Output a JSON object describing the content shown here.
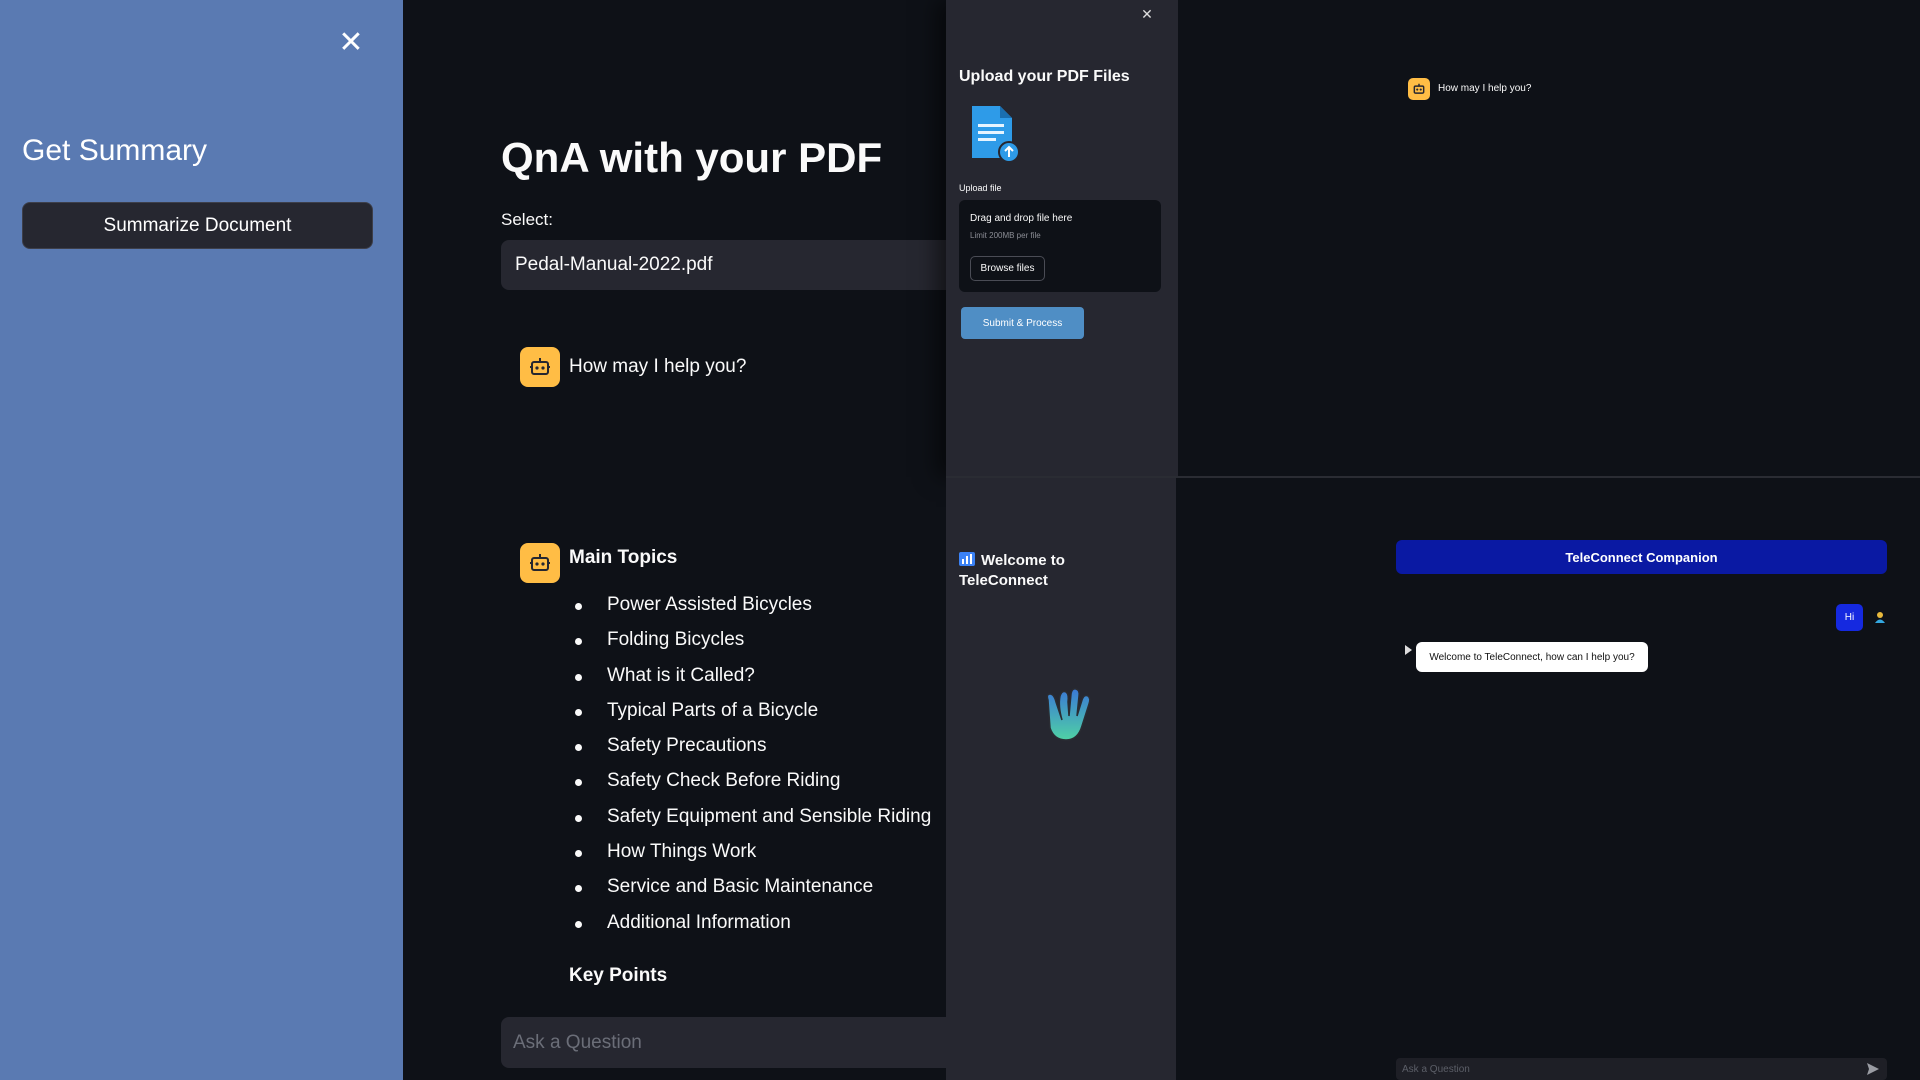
{
  "left_sidebar": {
    "close_icon": "close-icon",
    "title": "Get Summary",
    "summarize_button": "Summarize Document",
    "bg_color": "#5a7ab2"
  },
  "qna": {
    "title": "QnA with your PDF",
    "select_label": "Select:",
    "selected_file": "Pedal-Manual-2022.pdf",
    "greeting": "How may I help you?",
    "topics_heading": "Main Topics",
    "topics": [
      "Power Assisted Bicycles",
      "Folding Bicycles",
      "What is it Called?",
      "Typical Parts of a Bicycle",
      "Safety Precautions",
      "Safety Check Before Riding",
      "Safety Equipment and Sensible Riding",
      "How Things Work",
      "Service and Basic Maintenance",
      "Additional Information"
    ],
    "key_points_heading": "Key Points",
    "ask_placeholder": "Ask a Question",
    "avatar_icon": "robot-icon",
    "avatar_color": "#ffbd45"
  },
  "upload": {
    "close_icon": "close-icon",
    "title": "Upload your PDF Files",
    "pdf_icon": "pdf-upload-icon",
    "upload_label": "Upload file",
    "drop_title": "Drag and drop file here",
    "drop_limit": "Limit 200MB per file",
    "browse_button": "Browse files",
    "submit_button": "Submit & Process",
    "submit_color": "#4f8ec5"
  },
  "top_right_chat": {
    "greeting": "How may I help you?"
  },
  "teleconnect": {
    "welcome_title": "Welcome to TeleConnect",
    "welcome_icon": "chart-icon",
    "wave_icon": "waving-hand-icon",
    "header": "TeleConnect Companion",
    "header_color": "#0a19a3",
    "user_message": "Hi",
    "bot_message": "Welcome to TeleConnect, how can I help you?",
    "ask_placeholder": "Ask a Question",
    "send_icon": "send-icon"
  }
}
